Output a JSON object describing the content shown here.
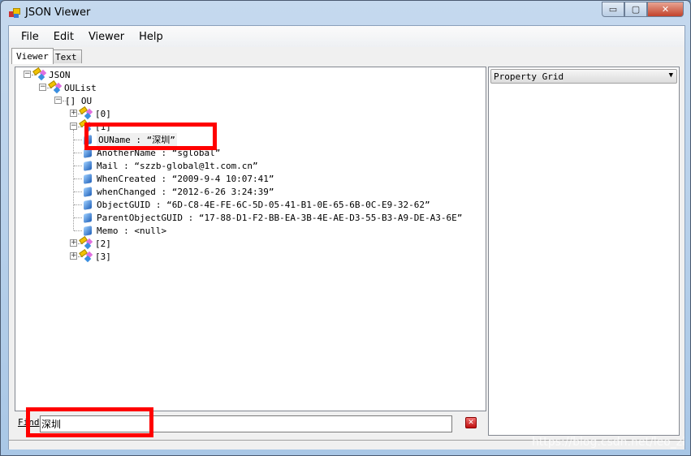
{
  "window": {
    "title": "JSON Viewer",
    "minimize": "▭",
    "maximize": "▢",
    "close": "✕"
  },
  "menu": [
    "File",
    "Edit",
    "Viewer",
    "Help"
  ],
  "tabs": [
    {
      "label": "Viewer",
      "active": true
    },
    {
      "label": "Text",
      "active": false
    }
  ],
  "tree": [
    {
      "label": "JSON",
      "depth": 0,
      "type": "object",
      "expanded": true
    },
    {
      "label": "OUList",
      "depth": 1,
      "type": "object",
      "expanded": true
    },
    {
      "label": "[] OU",
      "depth": 2,
      "type": "array",
      "expanded": true
    },
    {
      "label": "[0]",
      "depth": 3,
      "type": "object",
      "expanded": false
    },
    {
      "label": "[1]",
      "depth": 3,
      "type": "object",
      "expanded": true
    },
    {
      "label": "OUName : “深圳”",
      "depth": 4,
      "type": "value",
      "selected": true
    },
    {
      "label": "AnotherName : “sglobal”",
      "depth": 4,
      "type": "value"
    },
    {
      "label": "Mail : “szzb-global@1t.com.cn”",
      "depth": 4,
      "type": "value"
    },
    {
      "label": "WhenCreated : “2009-9-4 10:07:41”",
      "depth": 4,
      "type": "value"
    },
    {
      "label": "whenChanged : “2012-6-26 3:24:39”",
      "depth": 4,
      "type": "value"
    },
    {
      "label": "ObjectGUID : “6D-C8-4E-FE-6C-5D-05-41-B1-0E-65-6B-0C-E9-32-62”",
      "depth": 4,
      "type": "value"
    },
    {
      "label": "ParentObjectGUID : “17-88-D1-F2-BB-EA-3B-4E-AE-D3-55-B3-A9-DE-A3-6E”",
      "depth": 4,
      "type": "value"
    },
    {
      "label": "Memo : <null>",
      "depth": 4,
      "type": "value"
    },
    {
      "label": "[2]",
      "depth": 3,
      "type": "object",
      "expanded": false
    },
    {
      "label": "[3]",
      "depth": 3,
      "type": "object",
      "expanded": false
    }
  ],
  "property_grid": {
    "selected": "Property Grid"
  },
  "find": {
    "label": "Find",
    "value": "深圳",
    "clear_icon": "clear-x-icon"
  },
  "watermark": "https://blog.csdn.net/leo_zi",
  "colors": {
    "highlight": "#ff0000",
    "close_button": "#c2422b"
  }
}
